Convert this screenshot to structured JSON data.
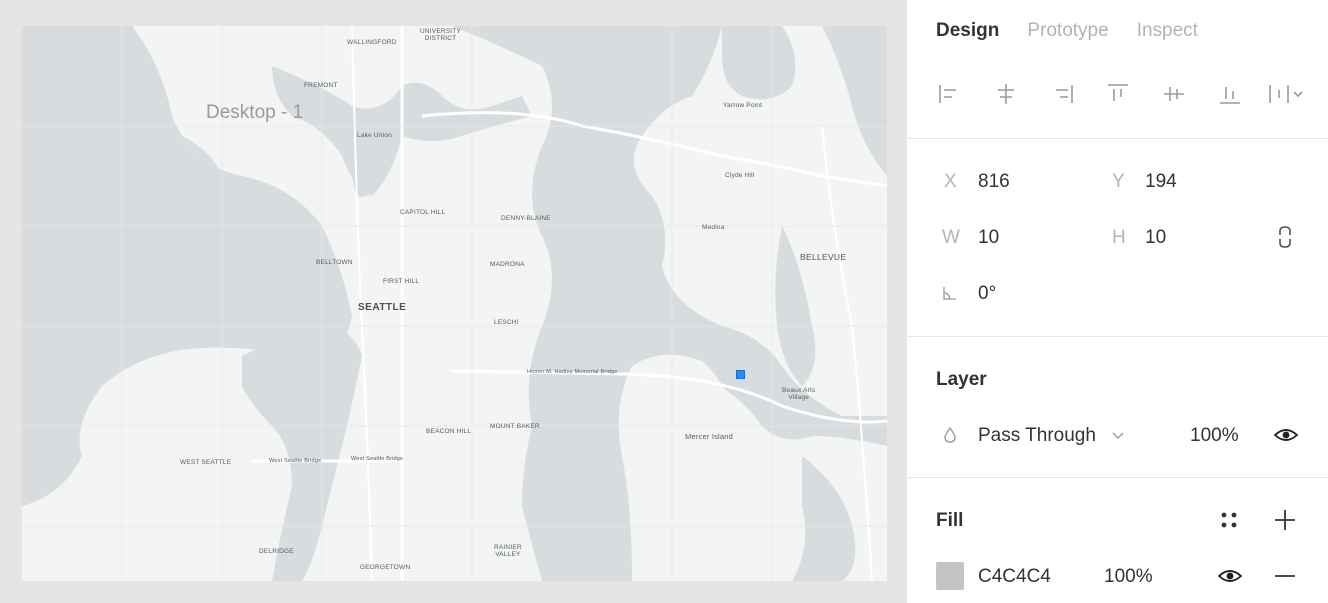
{
  "canvas": {
    "frame_label": "Desktop - 1",
    "map_labels": {
      "university_district": "UNIVERSITY\nDISTRICT",
      "wallingford": "WALLINGFORD",
      "fremont": "FREMONT",
      "lake_union": "Lake Union",
      "yarrow_point": "Yarrow Point",
      "clyde_hill": "Clyde Hill",
      "medina": "Medina",
      "bellevue": "BELLEVUE",
      "capitol_hill": "CAPITOL HILL",
      "denny_blaine": "DENNY-BLAINE",
      "belltown": "BELLTOWN",
      "madrona": "MADRONA",
      "first_hill": "FIRST HILL",
      "seattle": "SEATTLE",
      "leschi": "LESCHI",
      "bridge": "Homer M. Hadley Memorial Bridge",
      "beaux_arts": "Beaux Arts\nVillage",
      "beacon_hill": "BEACON HILL",
      "mount_baker": "MOUNT BAKER",
      "mercer_island": "Mercer Island",
      "west_seattle": "WEST SEATTLE",
      "west_seattle_bridge_1": "West Seattle Bridge",
      "west_seattle_bridge_2": "West Seattle Bridge",
      "delridge": "DELRIDGE",
      "georgetown": "GEORGETOWN",
      "rainier_valley": "RAINIER\nVALLEY"
    }
  },
  "panel": {
    "tabs": [
      "Design",
      "Prototype",
      "Inspect"
    ],
    "position": {
      "x_label": "X",
      "x_value": "816",
      "y_label": "Y",
      "y_value": "194",
      "w_label": "W",
      "w_value": "10",
      "h_label": "H",
      "h_value": "10",
      "rotation_value": "0°"
    },
    "layer": {
      "title": "Layer",
      "blend_mode": "Pass Through",
      "opacity": "100%"
    },
    "fill": {
      "title": "Fill",
      "hex": "C4C4C4",
      "opacity": "100%",
      "color": "#c4c4c4"
    }
  },
  "colors": {
    "water": "#d9dcde",
    "land": "#f3f4f4",
    "selection": "#2d8cf0"
  }
}
